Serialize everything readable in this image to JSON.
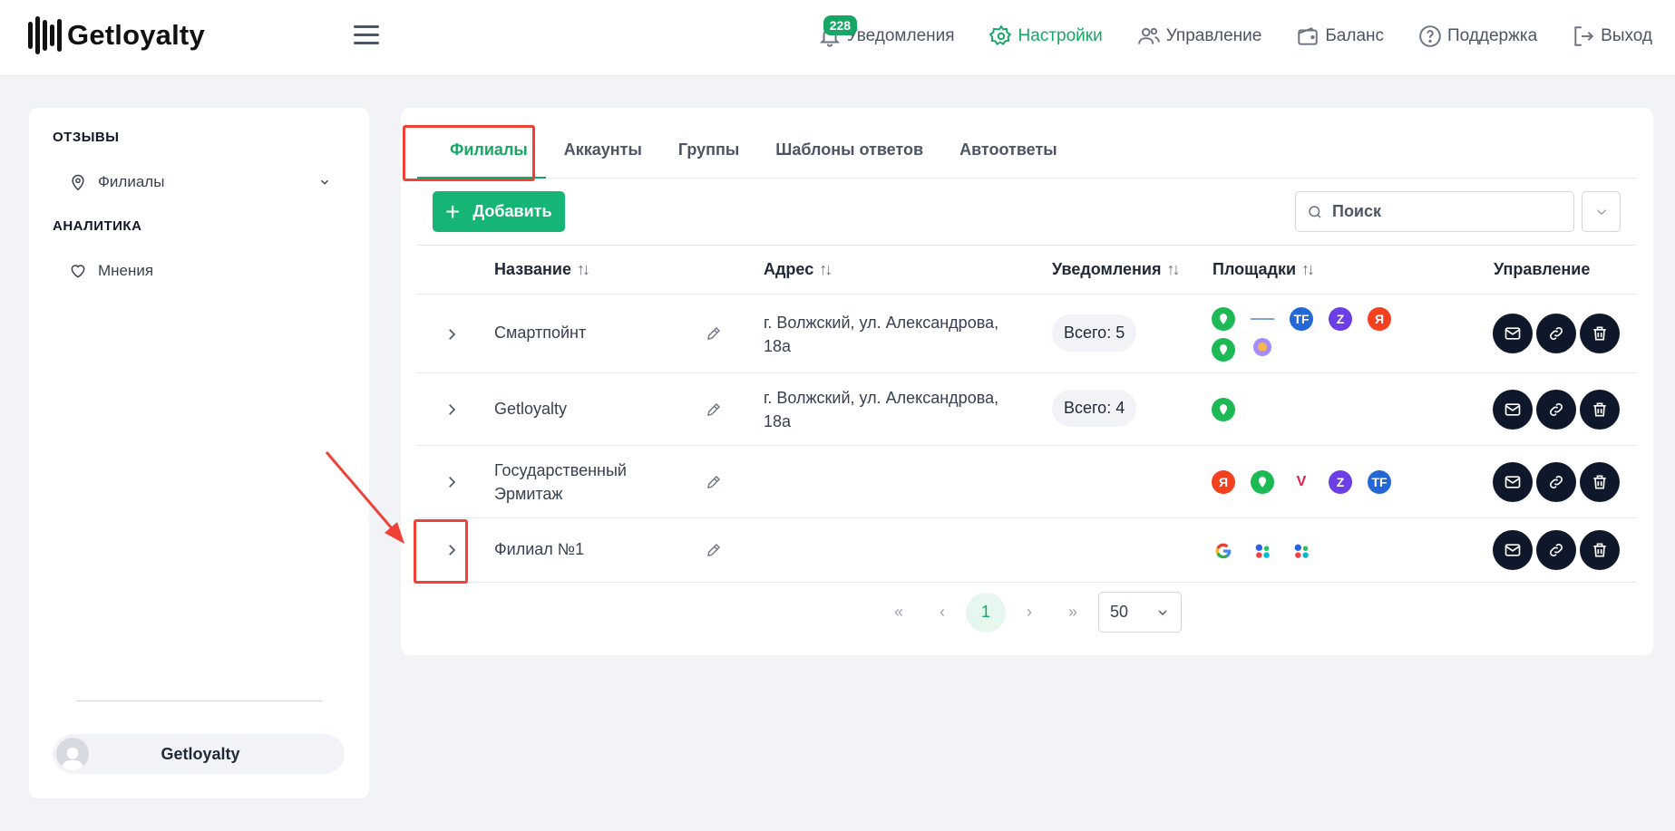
{
  "header": {
    "logo_text": "Getloyalty",
    "notifications_badge": "228",
    "nav": [
      {
        "label": "Уведомления",
        "icon": "bell-icon"
      },
      {
        "label": "Настройки",
        "icon": "gear-icon",
        "active": true
      },
      {
        "label": "Управление",
        "icon": "users-icon"
      },
      {
        "label": "Баланс",
        "icon": "wallet-icon"
      },
      {
        "label": "Поддержка",
        "icon": "help-icon"
      },
      {
        "label": "Выход",
        "icon": "logout-icon"
      }
    ],
    "accent_color": "#16a765"
  },
  "sidebar": {
    "sections": [
      {
        "title": "ОТЗЫВЫ",
        "items": [
          {
            "label": "Филиалы",
            "icon": "map-pin-icon"
          }
        ]
      },
      {
        "title": "АНАЛИТИКА",
        "items": [
          {
            "label": "Мнения",
            "icon": "heart-icon"
          }
        ]
      }
    ],
    "user_name": "Getloyalty"
  },
  "tabs": [
    "Филиалы",
    "Аккаунты",
    "Группы",
    "Шаблоны ответов",
    "Автоответы"
  ],
  "toolbar": {
    "add_label": "Добавить",
    "search_placeholder": "Поиск"
  },
  "table": {
    "columns": [
      "Название",
      "Адрес",
      "Уведомления",
      "Площадки",
      "Управление"
    ],
    "rows": [
      {
        "name": "Смартпойнт",
        "address": "г. Волжский, ул. Александрова, 18а",
        "notifications": "Всего: 5",
        "platforms": [
          "2gis",
          "flamp",
          "tf",
          "zoon",
          "yandex",
          "2gis",
          "globe"
        ]
      },
      {
        "name": "Getloyalty",
        "address": "г. Волжский, ул. Александрова, 18а",
        "notifications": "Всего: 4",
        "platforms": [
          "2gis"
        ]
      },
      {
        "name": "Государственный Эрмитаж",
        "address": "",
        "notifications": "",
        "platforms": [
          "yandex",
          "2gis",
          "vlru",
          "zoon",
          "tf"
        ]
      },
      {
        "name": "Филиал №1",
        "address": "",
        "notifications": "",
        "platforms": [
          "google",
          "dots",
          "dots"
        ]
      }
    ]
  },
  "pagination": {
    "first": "«",
    "prev": "‹",
    "current": "1",
    "next": "›",
    "last": "»",
    "per_page": "50"
  }
}
